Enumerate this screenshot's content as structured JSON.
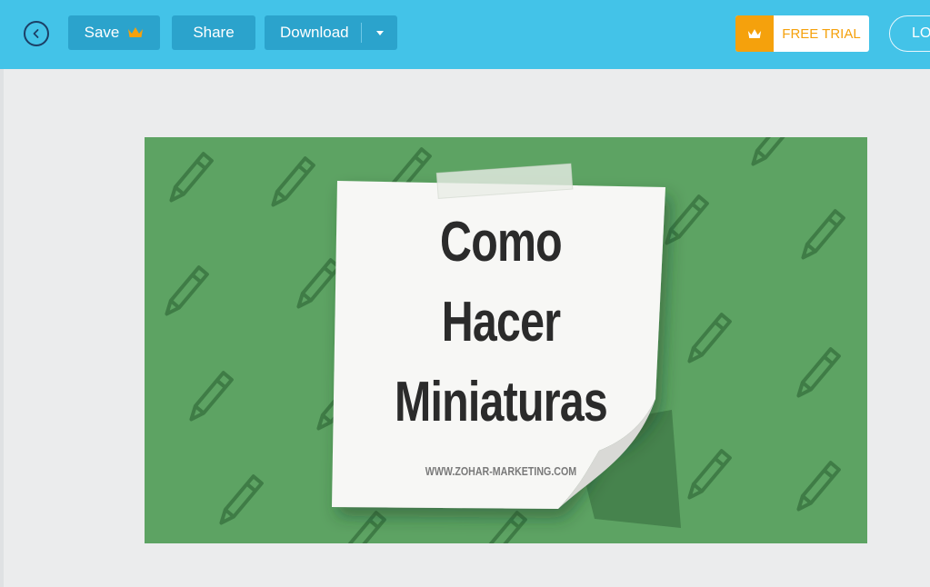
{
  "toolbar": {
    "save_label": "Save",
    "share_label": "Share",
    "download_label": "Download",
    "free_trial_label": "FREE TRIAL",
    "login_label": "LOG IN"
  },
  "icons": {
    "back": "chevron-left-circle-icon",
    "premium": "crown-icon",
    "dropdown": "caret-down-icon"
  },
  "colors": {
    "topbar": "#43c3e8",
    "button": "#2ba3cc",
    "accent": "#f5a10c",
    "canvas_bg": "#5da363"
  },
  "design": {
    "title_lines": [
      "Como",
      "Hacer",
      "Miniaturas"
    ],
    "website": "WWW.ZOHAR-MARKETING.COM"
  }
}
